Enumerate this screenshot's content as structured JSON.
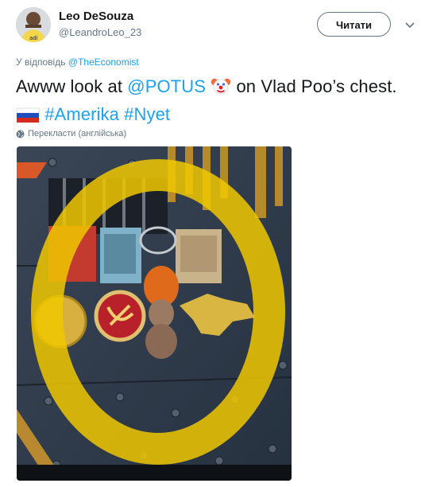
{
  "author": {
    "display_name": "Leo DeSouza",
    "username": "@LeandroLeo_23"
  },
  "follow_button_label": "Читати",
  "reply": {
    "prefix": "У відповідь ",
    "handle": "@TheEconomist"
  },
  "tweet": {
    "part1": "Awww look at ",
    "mention": "@POTUS",
    "emoji1": "clown-face-emoji",
    "part2": " on Vlad Poo’s chest. ",
    "emoji2": "russia-flag-emoji",
    "hashtag1": "#Amerika",
    "hashtag2": "#Nyet"
  },
  "translate_label": "Перекласти (англійська)",
  "colors": {
    "link": "#1da1f2",
    "secondary_text": "#657786",
    "primary_text": "#14171a",
    "highlight": "#f0c800"
  }
}
